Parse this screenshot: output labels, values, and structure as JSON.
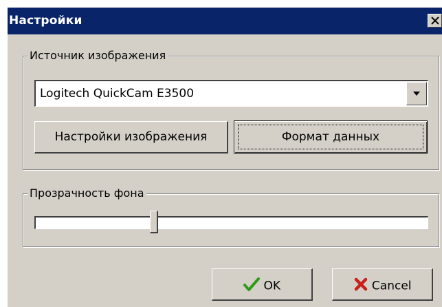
{
  "window": {
    "title": "Настройки"
  },
  "image_source": {
    "group_label": "Источник изображения",
    "selected_device": "Logitech QuickCam E3500",
    "image_settings_label": "Настройки изображения",
    "data_format_label": "Формат данных"
  },
  "background_transparency": {
    "group_label": "Прозрачность фона",
    "level": 0.3
  },
  "actions": {
    "ok_label": "OK",
    "cancel_label": "Cancel"
  },
  "icons": {
    "title_close": "close-icon",
    "combo_dropdown": "dropdown-arrow-icon",
    "ok": "check-icon",
    "cancel": "cross-icon"
  },
  "colors": {
    "titlebar": "#0a246a",
    "face": "#d4d0c8",
    "ok_check": "#2f9a1a",
    "cancel_cross": "#c8201a"
  }
}
